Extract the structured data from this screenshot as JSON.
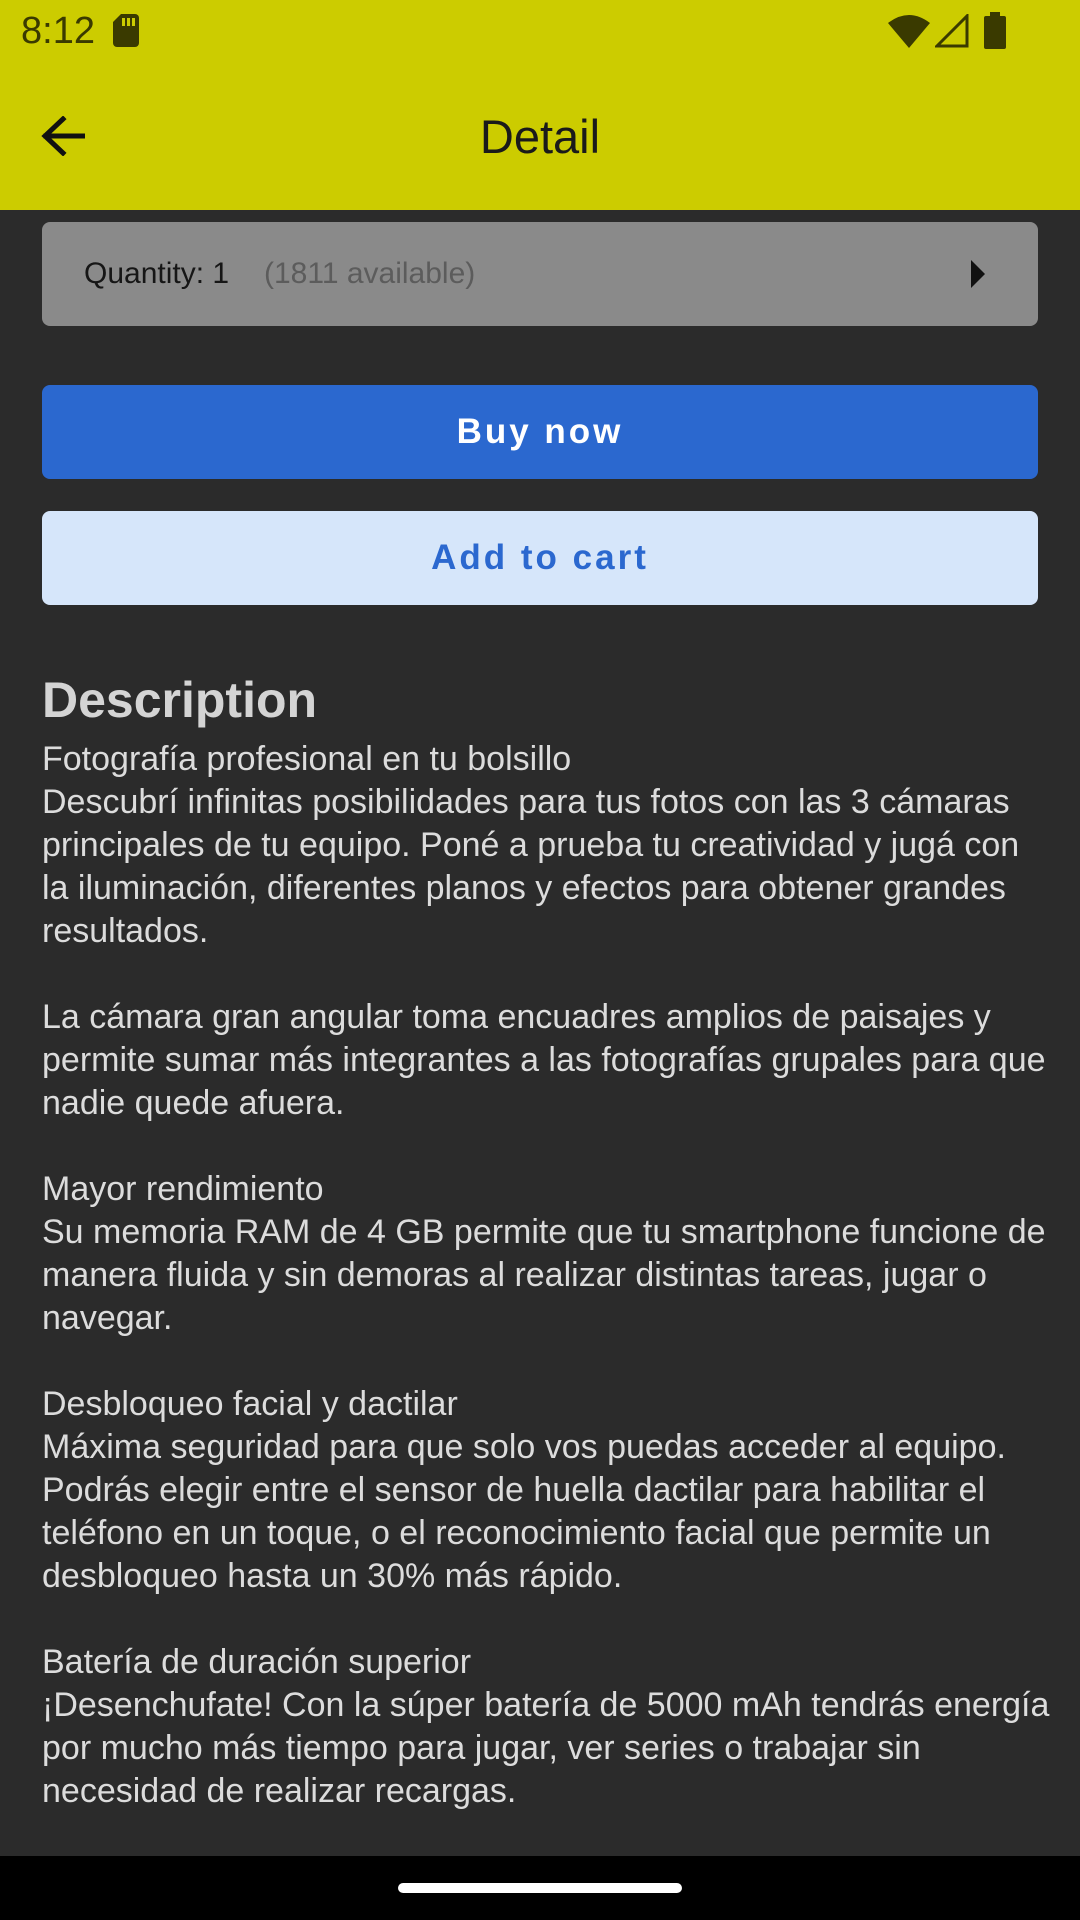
{
  "status_bar": {
    "time": "8:12",
    "icons": [
      "sd-card-icon",
      "wifi-icon",
      "signal-icon",
      "battery-icon"
    ]
  },
  "app_bar": {
    "title": "Detail",
    "back_icon": "arrow-back-icon"
  },
  "quantity": {
    "label": "Quantity: 1",
    "available": "(1811 available)",
    "icon": "chevron-right-icon"
  },
  "actions": {
    "buy_label": "Buy now",
    "cart_label": "Add to cart"
  },
  "description": {
    "heading": "Description",
    "body": "Fotografía profesional en tu bolsillo\nDescubrí infinitas posibilidades para tus fotos con las 3 cámaras principales de tu equipo. Poné a prueba tu creatividad y jugá con la iluminación, diferentes planos y efectos para obtener grandes resultados.\n\nLa cámara gran angular toma encuadres amplios de paisajes y permite sumar más integrantes a las fotografías grupales para que nadie quede afuera.\n\nMayor rendimiento\nSu memoria RAM de 4 GB permite que tu smartphone funcione de manera fluida y sin demoras al realizar distintas tareas, jugar o navegar.\n\nDesbloqueo facial y dactilar\nMáxima seguridad para que solo vos puedas acceder al equipo. Podrás elegir entre el sensor de huella dactilar para habilitar el teléfono en un toque, o el reconocimiento facial que permite un desbloqueo hasta un 30% más rápido.\n\nBatería de duración superior\n¡Desenchufate! Con la súper batería de 5000 mAh tendrás energía por mucho más tiempo para jugar, ver series o trabajar sin necesidad de realizar recargas."
  },
  "colors": {
    "app_bar": "#cccc00",
    "background": "#2b2b2b",
    "primary": "#2b68cf",
    "secondary_bg": "#d6e6fa"
  }
}
